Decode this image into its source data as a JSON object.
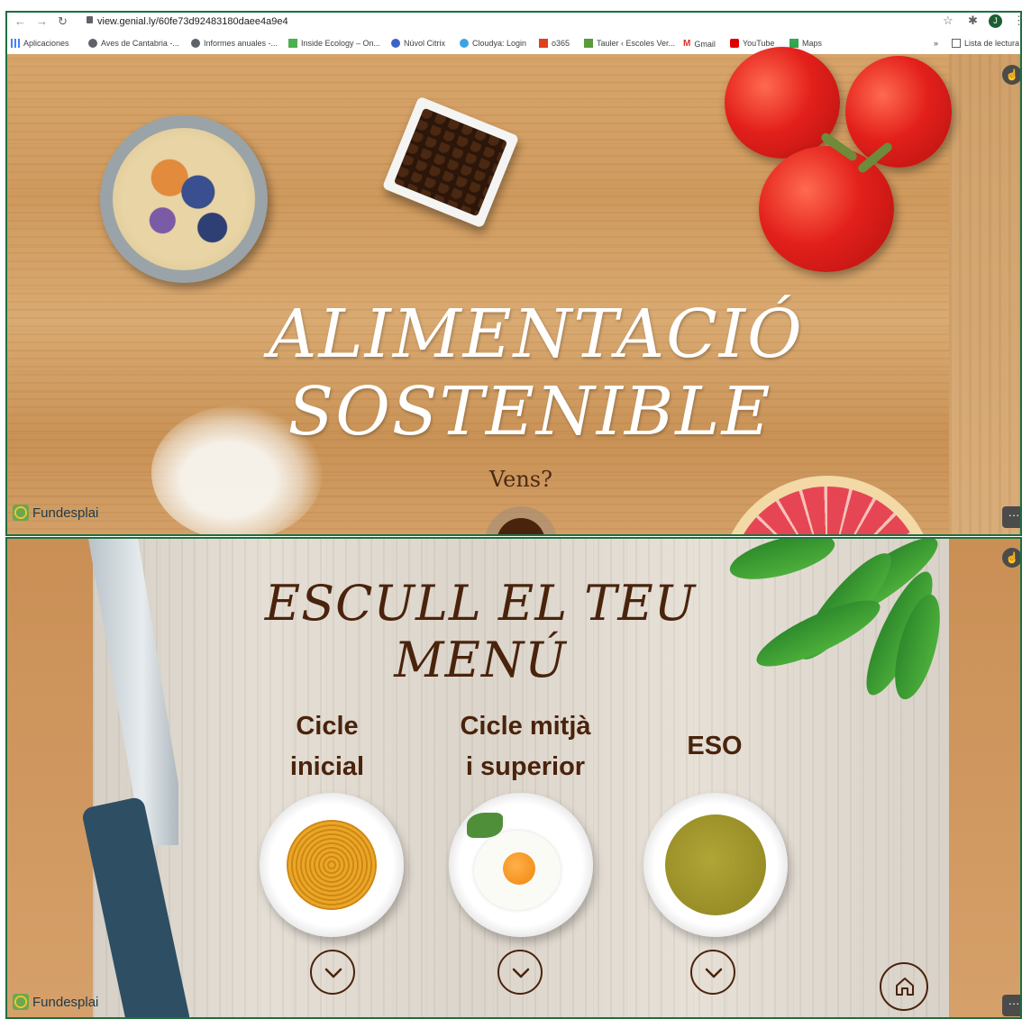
{
  "browser": {
    "url": "view.genial.ly/60fe73d92483180daee4a9e4",
    "avatar_letter": "J",
    "overflow": "»",
    "reading_list": "Lista de lectura",
    "bookmarks": [
      {
        "label": "Aplicaciones",
        "icon": "apps-grid-icon",
        "color": "#4285f4"
      },
      {
        "label": "Aves de Cantabria -...",
        "icon": "globe-icon",
        "color": "#5f6368"
      },
      {
        "label": "Informes anuales -...",
        "icon": "globe-icon",
        "color": "#5f6368"
      },
      {
        "label": "Inside Ecology – On...",
        "icon": "square-icon",
        "color": "#4caf50"
      },
      {
        "label": "Núvol Citrix",
        "icon": "citrix-icon",
        "color": "#3c63c8"
      },
      {
        "label": "Cloudya: Login",
        "icon": "clock-icon",
        "color": "#3aa3e3"
      },
      {
        "label": "o365",
        "icon": "office-icon",
        "color": "#e0401c"
      },
      {
        "label": "Tauler ‹ Escoles Ver...",
        "icon": "tree-icon",
        "color": "#5a9b3a"
      },
      {
        "label": "Gmail",
        "icon": "gmail-icon",
        "color": "#d93025"
      },
      {
        "label": "YouTube",
        "icon": "youtube-icon",
        "color": "#e00000"
      },
      {
        "label": "Maps",
        "icon": "maps-icon",
        "color": "#34a853"
      }
    ]
  },
  "slide1": {
    "title_line1": "ALIMENTACIÓ",
    "title_line2": "SOSTENIBLE",
    "subtitle": "Vens?",
    "logo": "Fundesplai",
    "more": "···"
  },
  "slide2": {
    "title": "ESCULL EL TEU MENÚ",
    "options": [
      {
        "line1": "Cicle",
        "line2": "inicial"
      },
      {
        "line1": "Cicle mitjà",
        "line2": "i superior"
      },
      {
        "line1": "ESO",
        "line2": ""
      }
    ],
    "logo": "Fundesplai",
    "more": "···"
  },
  "colors": {
    "brand_brown": "#4a230c",
    "frame_green": "#1f6f3f"
  }
}
